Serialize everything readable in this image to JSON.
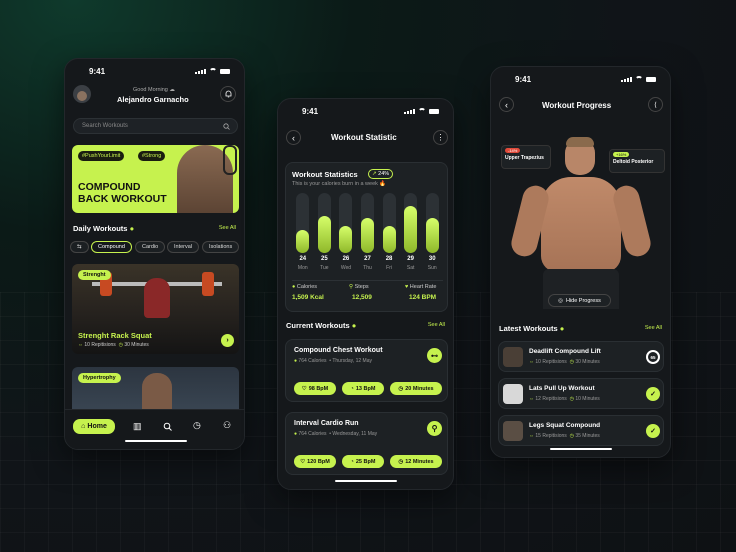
{
  "accent": "#c6f24e",
  "p1": {
    "time": "9:41",
    "greeting": "Good Morning ☁",
    "user": "Alejandro Garnacho",
    "search_placeholder": "Search Workouts",
    "hero": {
      "tag1": "#PushYourLimit",
      "tag2": "#Strong",
      "title1": "COMPOUND",
      "title2": "BACK WORKOUT"
    },
    "daily_title": "Daily Workouts",
    "see_all": "See All",
    "filters": [
      "Compound",
      "Cardio",
      "Interval",
      "Isolations"
    ],
    "workout1": {
      "tag": "Strenght",
      "title": "Strenght Rack Squat",
      "reps": "10 Repitisions",
      "mins": "30 Minutes"
    },
    "workout2": {
      "tag": "Hypertrophy"
    },
    "nav": {
      "home": "Home"
    }
  },
  "p2": {
    "time": "9:41",
    "title": "Workout Statistic",
    "stats_title": "Workout Statistics",
    "delta": "24%",
    "subtitle": "This is your calories burn in a week 🔥",
    "metrics": [
      {
        "label": "Calories",
        "value": "1,509 Kcal"
      },
      {
        "label": "Steps",
        "value": "12,509"
      },
      {
        "label": "Heart Rate",
        "value": "124 BPM"
      }
    ],
    "current_title": "Current Workouts",
    "see_all": "See All",
    "w1": {
      "title": "Compound Chest Workout",
      "cal": "764 Calories",
      "date": "Thursday, 12 May",
      "p1": "98 BpM",
      "p2": "13 BpM",
      "p3": "20 Minutes"
    },
    "w2": {
      "title": "Interval Cardio Run",
      "cal": "764 Calories",
      "date": "Wednesday, 11 May",
      "p1": "120 BpM",
      "p2": "25 BpM",
      "p3": "12 Minutes"
    }
  },
  "chart_data": {
    "type": "bar",
    "categories": [
      "24",
      "25",
      "26",
      "27",
      "28",
      "29",
      "30"
    ],
    "days": [
      "Mon",
      "Tue",
      "Wed",
      "Thu",
      "Fri",
      "Sat",
      "Sun"
    ],
    "values": [
      0.38,
      0.62,
      0.45,
      0.58,
      0.45,
      0.78,
      0.58
    ],
    "ylim": [
      0,
      1
    ]
  },
  "p3": {
    "time": "9:41",
    "title": "Workout Progress",
    "tag_left": {
      "badge": "-14%",
      "label": "Upper Trapezius"
    },
    "tag_right": {
      "badge": "+16%",
      "label": "Deltoid Posterior"
    },
    "hide": "Hide Progress",
    "latest_title": "Latest Workouts",
    "see_all": "See All",
    "items": [
      {
        "title": "Deadlift Compound Lift",
        "reps": "10 Repitisions",
        "mins": "30 Minutes",
        "status": "65"
      },
      {
        "title": "Lats Pull Up Workout",
        "reps": "12 Repitisions",
        "mins": "10 Minutes",
        "status": "✓"
      },
      {
        "title": "Legs Squat Compound",
        "reps": "15 Repitisions",
        "mins": "35 Minutes",
        "status": "✓"
      }
    ]
  }
}
